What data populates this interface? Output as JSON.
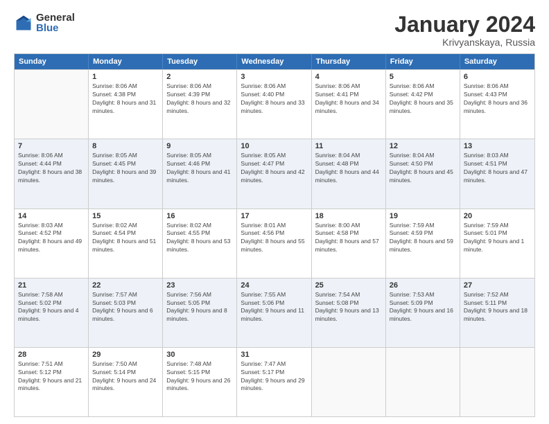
{
  "logo": {
    "general": "General",
    "blue": "Blue"
  },
  "title": {
    "month": "January 2024",
    "location": "Krivyanskaya, Russia"
  },
  "headers": [
    "Sunday",
    "Monday",
    "Tuesday",
    "Wednesday",
    "Thursday",
    "Friday",
    "Saturday"
  ],
  "weeks": [
    [
      {
        "day": "",
        "sunrise": "",
        "sunset": "",
        "daylight": ""
      },
      {
        "day": "1",
        "sunrise": "Sunrise: 8:06 AM",
        "sunset": "Sunset: 4:38 PM",
        "daylight": "Daylight: 8 hours and 31 minutes."
      },
      {
        "day": "2",
        "sunrise": "Sunrise: 8:06 AM",
        "sunset": "Sunset: 4:39 PM",
        "daylight": "Daylight: 8 hours and 32 minutes."
      },
      {
        "day": "3",
        "sunrise": "Sunrise: 8:06 AM",
        "sunset": "Sunset: 4:40 PM",
        "daylight": "Daylight: 8 hours and 33 minutes."
      },
      {
        "day": "4",
        "sunrise": "Sunrise: 8:06 AM",
        "sunset": "Sunset: 4:41 PM",
        "daylight": "Daylight: 8 hours and 34 minutes."
      },
      {
        "day": "5",
        "sunrise": "Sunrise: 8:06 AM",
        "sunset": "Sunset: 4:42 PM",
        "daylight": "Daylight: 8 hours and 35 minutes."
      },
      {
        "day": "6",
        "sunrise": "Sunrise: 8:06 AM",
        "sunset": "Sunset: 4:43 PM",
        "daylight": "Daylight: 8 hours and 36 minutes."
      }
    ],
    [
      {
        "day": "7",
        "sunrise": "Sunrise: 8:06 AM",
        "sunset": "Sunset: 4:44 PM",
        "daylight": "Daylight: 8 hours and 38 minutes."
      },
      {
        "day": "8",
        "sunrise": "Sunrise: 8:05 AM",
        "sunset": "Sunset: 4:45 PM",
        "daylight": "Daylight: 8 hours and 39 minutes."
      },
      {
        "day": "9",
        "sunrise": "Sunrise: 8:05 AM",
        "sunset": "Sunset: 4:46 PM",
        "daylight": "Daylight: 8 hours and 41 minutes."
      },
      {
        "day": "10",
        "sunrise": "Sunrise: 8:05 AM",
        "sunset": "Sunset: 4:47 PM",
        "daylight": "Daylight: 8 hours and 42 minutes."
      },
      {
        "day": "11",
        "sunrise": "Sunrise: 8:04 AM",
        "sunset": "Sunset: 4:48 PM",
        "daylight": "Daylight: 8 hours and 44 minutes."
      },
      {
        "day": "12",
        "sunrise": "Sunrise: 8:04 AM",
        "sunset": "Sunset: 4:50 PM",
        "daylight": "Daylight: 8 hours and 45 minutes."
      },
      {
        "day": "13",
        "sunrise": "Sunrise: 8:03 AM",
        "sunset": "Sunset: 4:51 PM",
        "daylight": "Daylight: 8 hours and 47 minutes."
      }
    ],
    [
      {
        "day": "14",
        "sunrise": "Sunrise: 8:03 AM",
        "sunset": "Sunset: 4:52 PM",
        "daylight": "Daylight: 8 hours and 49 minutes."
      },
      {
        "day": "15",
        "sunrise": "Sunrise: 8:02 AM",
        "sunset": "Sunset: 4:54 PM",
        "daylight": "Daylight: 8 hours and 51 minutes."
      },
      {
        "day": "16",
        "sunrise": "Sunrise: 8:02 AM",
        "sunset": "Sunset: 4:55 PM",
        "daylight": "Daylight: 8 hours and 53 minutes."
      },
      {
        "day": "17",
        "sunrise": "Sunrise: 8:01 AM",
        "sunset": "Sunset: 4:56 PM",
        "daylight": "Daylight: 8 hours and 55 minutes."
      },
      {
        "day": "18",
        "sunrise": "Sunrise: 8:00 AM",
        "sunset": "Sunset: 4:58 PM",
        "daylight": "Daylight: 8 hours and 57 minutes."
      },
      {
        "day": "19",
        "sunrise": "Sunrise: 7:59 AM",
        "sunset": "Sunset: 4:59 PM",
        "daylight": "Daylight: 8 hours and 59 minutes."
      },
      {
        "day": "20",
        "sunrise": "Sunrise: 7:59 AM",
        "sunset": "Sunset: 5:01 PM",
        "daylight": "Daylight: 9 hours and 1 minute."
      }
    ],
    [
      {
        "day": "21",
        "sunrise": "Sunrise: 7:58 AM",
        "sunset": "Sunset: 5:02 PM",
        "daylight": "Daylight: 9 hours and 4 minutes."
      },
      {
        "day": "22",
        "sunrise": "Sunrise: 7:57 AM",
        "sunset": "Sunset: 5:03 PM",
        "daylight": "Daylight: 9 hours and 6 minutes."
      },
      {
        "day": "23",
        "sunrise": "Sunrise: 7:56 AM",
        "sunset": "Sunset: 5:05 PM",
        "daylight": "Daylight: 9 hours and 8 minutes."
      },
      {
        "day": "24",
        "sunrise": "Sunrise: 7:55 AM",
        "sunset": "Sunset: 5:06 PM",
        "daylight": "Daylight: 9 hours and 11 minutes."
      },
      {
        "day": "25",
        "sunrise": "Sunrise: 7:54 AM",
        "sunset": "Sunset: 5:08 PM",
        "daylight": "Daylight: 9 hours and 13 minutes."
      },
      {
        "day": "26",
        "sunrise": "Sunrise: 7:53 AM",
        "sunset": "Sunset: 5:09 PM",
        "daylight": "Daylight: 9 hours and 16 minutes."
      },
      {
        "day": "27",
        "sunrise": "Sunrise: 7:52 AM",
        "sunset": "Sunset: 5:11 PM",
        "daylight": "Daylight: 9 hours and 18 minutes."
      }
    ],
    [
      {
        "day": "28",
        "sunrise": "Sunrise: 7:51 AM",
        "sunset": "Sunset: 5:12 PM",
        "daylight": "Daylight: 9 hours and 21 minutes."
      },
      {
        "day": "29",
        "sunrise": "Sunrise: 7:50 AM",
        "sunset": "Sunset: 5:14 PM",
        "daylight": "Daylight: 9 hours and 24 minutes."
      },
      {
        "day": "30",
        "sunrise": "Sunrise: 7:48 AM",
        "sunset": "Sunset: 5:15 PM",
        "daylight": "Daylight: 9 hours and 26 minutes."
      },
      {
        "day": "31",
        "sunrise": "Sunrise: 7:47 AM",
        "sunset": "Sunset: 5:17 PM",
        "daylight": "Daylight: 9 hours and 29 minutes."
      },
      {
        "day": "",
        "sunrise": "",
        "sunset": "",
        "daylight": ""
      },
      {
        "day": "",
        "sunrise": "",
        "sunset": "",
        "daylight": ""
      },
      {
        "day": "",
        "sunrise": "",
        "sunset": "",
        "daylight": ""
      }
    ]
  ]
}
